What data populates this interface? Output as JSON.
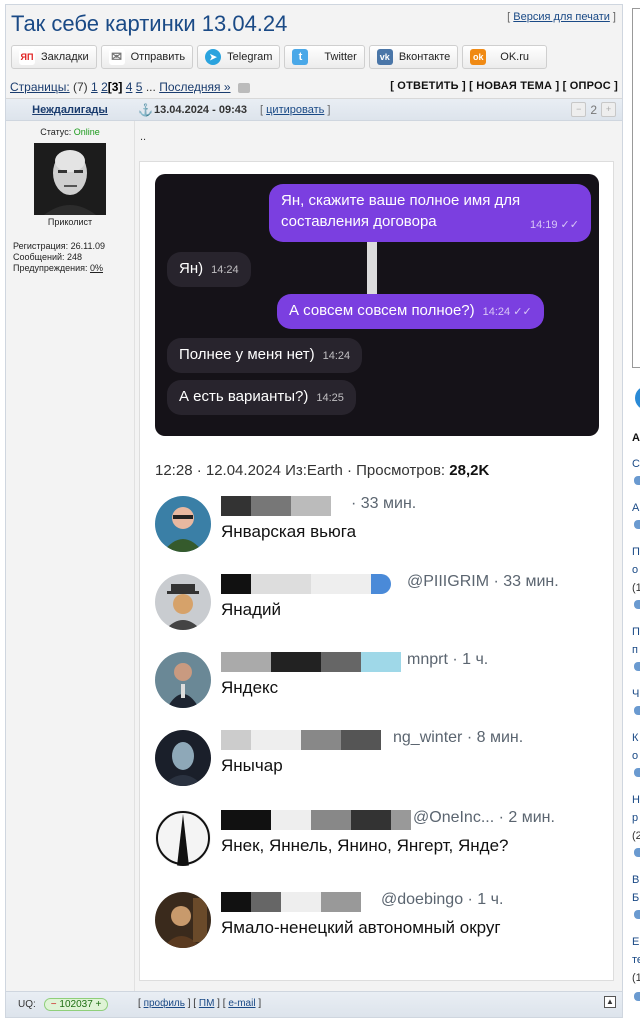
{
  "topic": {
    "title": "Так себе картинки 13.04.24",
    "print_version": "Версия для печати",
    "print_open": "[ ",
    "print_close": " ]"
  },
  "share": {
    "buttons": [
      {
        "label": "Закладки",
        "icon": "yandex-bookmarks-icon",
        "color": "#e02020",
        "glyph": "ЯП"
      },
      {
        "label": "Отправить",
        "icon": "mail-icon",
        "color": "#888888",
        "glyph": "✉"
      },
      {
        "label": "Telegram",
        "icon": "telegram-icon",
        "color": "#2aa3de",
        "glyph": "➤"
      },
      {
        "label": "Twitter",
        "icon": "twitter-icon",
        "color": "#4aa8e8",
        "glyph": "t"
      },
      {
        "label": "Вконтакте",
        "icon": "vk-icon",
        "color": "#4a76a8",
        "glyph": "vk"
      },
      {
        "label": "OK.ru",
        "icon": "odnoklassniki-icon",
        "color": "#f08a14",
        "glyph": "ok"
      }
    ]
  },
  "pager": {
    "label": "Страницы:",
    "total": "(7)",
    "pages": [
      "1",
      "2"
    ],
    "current": "[3]",
    "more_pages": [
      "4",
      "5"
    ],
    "ellipsis": "...",
    "last": "Последняя »",
    "reply": "[ ОТВЕТИТЬ ]",
    "new_topic": "[ НОВАЯ ТЕМА ]",
    "poll": "[ ОПРОС ]"
  },
  "post": {
    "author": "Неждалигады",
    "date": "13.04.2024 - 09:43",
    "quote": "цитировать",
    "rating": "2",
    "status_label": "Статус:",
    "status_value": "Online",
    "rank": "Приколист",
    "registration": "Регистрация: 26.11.09",
    "messages": "Сообщений: 248",
    "warnings_label": "Предупреждения:",
    "warnings_value": "0%",
    "text": ".."
  },
  "screenshot": {
    "chat": [
      {
        "dir": "out",
        "text_1": "Ян, скажите ваше полное имя для",
        "text_2": "составления договора",
        "time": "14:19 ✓✓"
      },
      {
        "dir": "in",
        "text": "Ян)",
        "time": "14:24"
      },
      {
        "dir": "out",
        "text": "А совсем совсем полное?)",
        "time": "14:24 ✓✓"
      },
      {
        "dir": "in",
        "text": "Полнее у меня нет)",
        "time": "14:24"
      },
      {
        "dir": "in",
        "text": "А есть варианты?)",
        "time": "14:25"
      }
    ],
    "tweet_meta_pre": "12:28 · 12.04.2024 Из:Earth · Просмотров:",
    "tweet_views": "28,2K",
    "replies": [
      {
        "handle": "· 33 мин.",
        "name": "Январская вьюга"
      },
      {
        "handle": "@PIIIGRIM · 33 мин.",
        "name": "Янадий"
      },
      {
        "handle": "mnprt · 1 ч.",
        "name": "Яндекс"
      },
      {
        "handle": "ng_winter · 8 мин.",
        "name": "Янычар"
      },
      {
        "handle": "@OneInc... · 2 мин.",
        "name": "Янек, Яннель, Янино, Янгерт, Янде?"
      },
      {
        "handle": "@doebingo · 1 ч.",
        "name": "Ямало-ненецкий автономный округ"
      }
    ]
  },
  "footer": {
    "uq_label": "UQ:",
    "uq_value": "102037",
    "profile": "профиль",
    "pm": "ПМ",
    "email": "e-mail"
  },
  "right_column": {
    "letters": [
      "А",
      "С",
      "А",
      "П",
      "о",
      "(1",
      "П",
      "п",
      "Ч",
      "К",
      "о",
      "Н",
      "р",
      "(2",
      "В",
      "Б",
      "E",
      "те",
      "(1"
    ]
  }
}
